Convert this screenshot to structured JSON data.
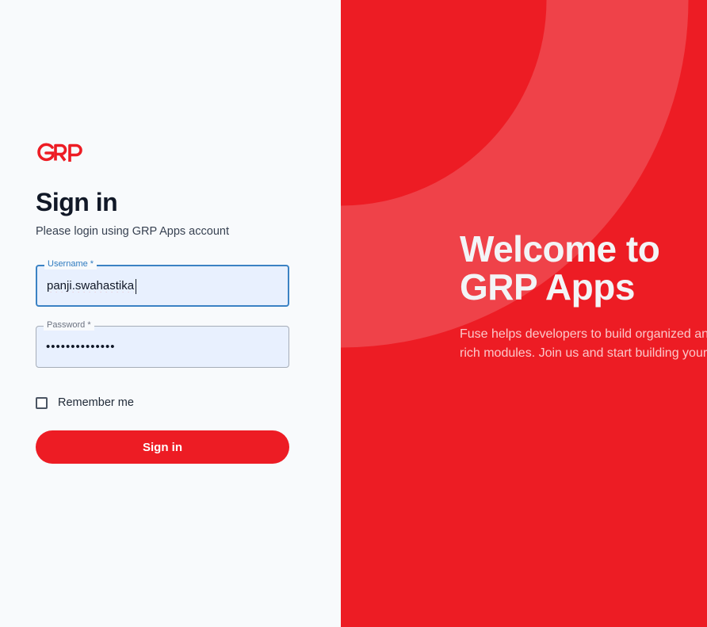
{
  "logo": {
    "text": "GRP",
    "icon": "grp-logo-icon",
    "color": "#ed1c24"
  },
  "signin": {
    "title": "Sign in",
    "subtitle": "Please login using GRP Apps account",
    "username_label": "Username *",
    "username_value": "panji.swahastika",
    "password_label": "Password *",
    "password_value": "••••••••••••••",
    "remember_label": "Remember me",
    "remember_checked": false,
    "button_label": "Sign in"
  },
  "hero": {
    "title_line1": "Welcome to",
    "title_line2": "GRP Apps",
    "desc_line1": "Fuse helps developers to build organized and well coded dashboards full of beautiful and",
    "desc_line2": "rich modules. Join us and start building your application today."
  },
  "colors": {
    "brand": "#ed1c24",
    "focus": "#3b82c4",
    "input_bg": "#e8f0fe"
  }
}
